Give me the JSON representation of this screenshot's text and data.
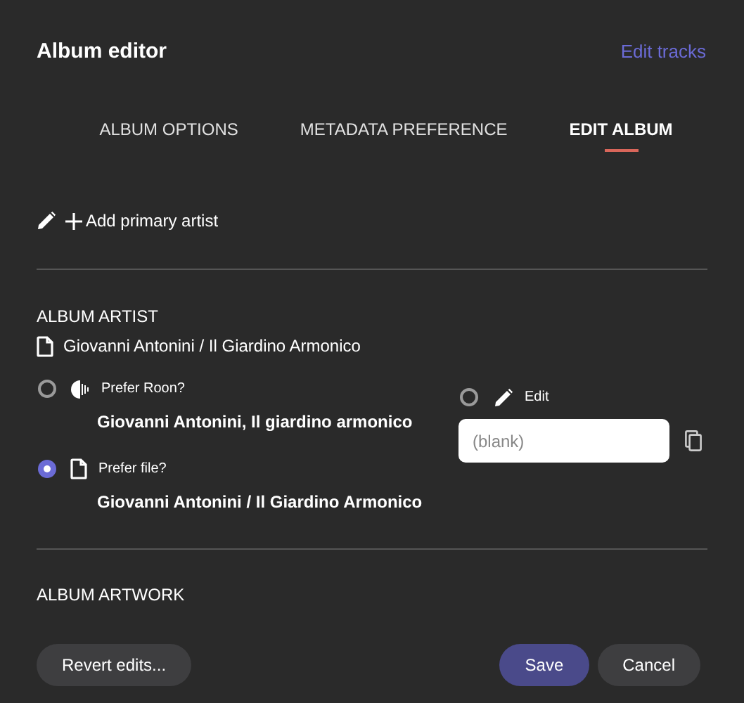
{
  "dialog": {
    "title": "Album editor",
    "link": "Edit tracks"
  },
  "tabs": [
    {
      "label": "ALBUM OPTIONS",
      "selected": false
    },
    {
      "label": "METADATA PREFERENCE",
      "selected": false
    },
    {
      "label": "EDIT ALBUM",
      "selected": true
    }
  ],
  "add_artist": {
    "label": "Add primary artist"
  },
  "album_artist": {
    "heading": "ALBUM ARTIST",
    "current": "Giovanni Antonini / Il Giardino Armonico",
    "options": [
      {
        "kind": "roon",
        "label": "Prefer Roon?",
        "value": "Giovanni Antonini, Il giardino armonico",
        "selected": false
      },
      {
        "kind": "file",
        "label": "Prefer file?",
        "value": "Giovanni Antonini / Il Giardino Armonico",
        "selected": true
      }
    ],
    "edit_option": {
      "label": "Edit",
      "selected": false,
      "placeholder": "(blank)"
    }
  },
  "album_artwork": {
    "heading": "ALBUM ARTWORK"
  },
  "footer": {
    "left": [
      {
        "label": "Revert edits...",
        "kind": "secondary"
      }
    ],
    "right": [
      {
        "label": "Save",
        "kind": "primary"
      },
      {
        "label": "Cancel",
        "kind": "secondary"
      }
    ]
  }
}
